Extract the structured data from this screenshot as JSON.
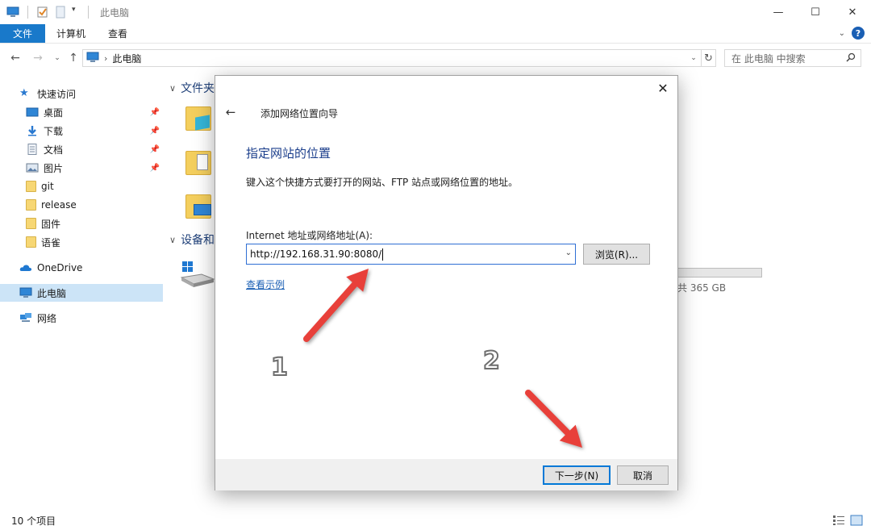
{
  "window": {
    "title": "此电脑",
    "controls": {
      "minimize": "—",
      "maximize": "☐",
      "close": "✕"
    }
  },
  "ribbon": {
    "tabs": [
      "文件",
      "计算机",
      "查看"
    ],
    "help": "?"
  },
  "address": {
    "path_item": "此电脑",
    "search_placeholder": "在 此电脑 中搜索"
  },
  "nav": {
    "quick_access": "快速访问",
    "items": [
      {
        "label": "桌面",
        "icon": "desktop-icon",
        "pinned": true
      },
      {
        "label": "下载",
        "icon": "download-icon",
        "pinned": true
      },
      {
        "label": "文档",
        "icon": "document-icon",
        "pinned": true
      },
      {
        "label": "图片",
        "icon": "picture-icon",
        "pinned": true
      },
      {
        "label": "git",
        "icon": "folder-icon",
        "pinned": false
      },
      {
        "label": "release",
        "icon": "folder-icon",
        "pinned": false
      },
      {
        "label": "固件",
        "icon": "folder-icon",
        "pinned": false
      },
      {
        "label": "语雀",
        "icon": "folder-icon",
        "pinned": false
      }
    ],
    "onedrive": "OneDrive",
    "this_pc": "此电脑",
    "network": "网络"
  },
  "content": {
    "group_folders": "文件夹",
    "group_devices": "设备和",
    "drive_info": "共 365 GB"
  },
  "status": {
    "item_count": "10 个项目"
  },
  "dialog": {
    "title": "添加网络位置向导",
    "heading": "指定网站的位置",
    "description": "键入这个快捷方式要打开的网站、FTP 站点或网络位置的地址。",
    "field_label": "Internet 地址或网络地址(A):",
    "field_value": "http://192.168.31.90:8080/",
    "browse": "浏览(R)...",
    "example_link": "查看示例",
    "next": "下一步(N)",
    "cancel": "取消"
  },
  "annotations": {
    "step1": "1",
    "step2": "2",
    "arrow_color": "#e8403a"
  }
}
